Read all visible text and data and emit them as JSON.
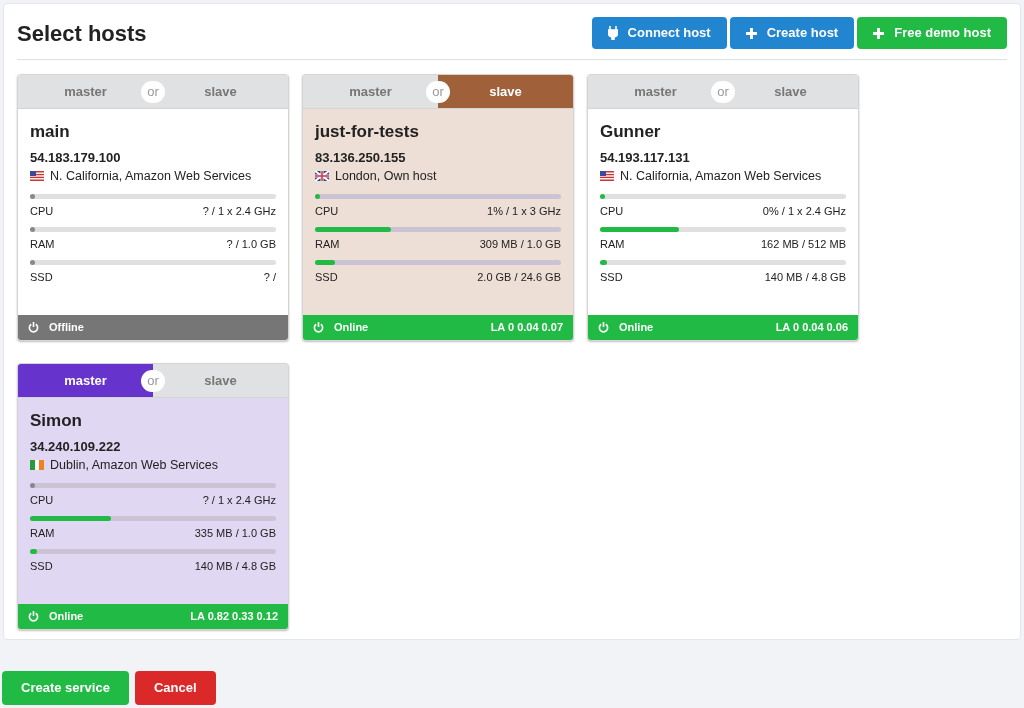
{
  "title": "Select hosts",
  "actions": [
    {
      "label": "Connect host",
      "kind": "connect",
      "color": "#2185d0"
    },
    {
      "label": "Create host",
      "kind": "add",
      "color": "#2185d0"
    },
    {
      "label": "Free demo host",
      "kind": "add",
      "color": "#21ba45"
    }
  ],
  "hosts": [
    {
      "roles": [
        {
          "label": "master",
          "selected": false
        },
        {
          "label": "slave",
          "selected": false
        }
      ],
      "separator": "or",
      "name": "main",
      "ip": "54.183.179.100",
      "flag": {
        "kind": "us"
      },
      "location": "N. California, Amazon Web Services",
      "online": false,
      "meters": [
        {
          "label": "CPU",
          "reading": "? / 1 x 2.4 GHz",
          "level": 0,
          "known": false
        },
        {
          "label": "RAM",
          "reading": "? / 1.0 GB",
          "level": 0,
          "known": false
        },
        {
          "label": "SSD",
          "reading": "? /",
          "level": 0,
          "known": false
        }
      ],
      "status": "Offline"
    },
    {
      "roles": [
        {
          "label": "master",
          "selected": false
        },
        {
          "label": "slave",
          "selected": true
        }
      ],
      "separator": "or",
      "name": "just-for-tests",
      "ip": "83.136.250.155",
      "flag": {
        "kind": "gb"
      },
      "location": "London, Own host",
      "online": true,
      "meters": [
        {
          "label": "CPU",
          "reading": "1% / 1 x 3 GHz",
          "level": 0.01,
          "known": true
        },
        {
          "label": "RAM",
          "reading": "309 MB / 1.0 GB",
          "level": 0.31,
          "known": true
        },
        {
          "label": "SSD",
          "reading": "2.0 GB / 24.6 GB",
          "level": 0.08,
          "known": true
        }
      ],
      "status": "Online",
      "load": "LA 0 0.04 0.07"
    },
    {
      "roles": [
        {
          "label": "master",
          "selected": false
        },
        {
          "label": "slave",
          "selected": false
        }
      ],
      "separator": "or",
      "name": "Gunner",
      "ip": "54.193.117.131",
      "flag": {
        "kind": "us"
      },
      "location": "N. California, Amazon Web Services",
      "online": true,
      "meters": [
        {
          "label": "CPU",
          "reading": "0% / 1 x 2.4 GHz",
          "level": 0,
          "known": true
        },
        {
          "label": "RAM",
          "reading": "162 MB / 512 MB",
          "level": 0.32,
          "known": true
        },
        {
          "label": "SSD",
          "reading": "140 MB / 4.8 GB",
          "level": 0.03,
          "known": true
        }
      ],
      "status": "Online",
      "load": "LA 0 0.04 0.06"
    },
    {
      "roles": [
        {
          "label": "master",
          "selected": true
        },
        {
          "label": "slave",
          "selected": false
        }
      ],
      "separator": "or",
      "name": "Simon",
      "ip": "34.240.109.222",
      "flag": {
        "kind": "ie"
      },
      "location": "Dublin, Amazon Web Services",
      "online": true,
      "meters": [
        {
          "label": "CPU",
          "reading": "? / 1 x 2.4 GHz",
          "level": 0,
          "known": false
        },
        {
          "label": "RAM",
          "reading": "335 MB / 1.0 GB",
          "level": 0.33,
          "known": true
        },
        {
          "label": "SSD",
          "reading": "140 MB / 4.8 GB",
          "level": 0.03,
          "known": true
        }
      ],
      "status": "Online",
      "load": "LA 0.82 0.33 0.12"
    }
  ],
  "footer": [
    {
      "label": "Create service",
      "kind": "primary"
    },
    {
      "label": "Cancel",
      "kind": "danger"
    }
  ]
}
